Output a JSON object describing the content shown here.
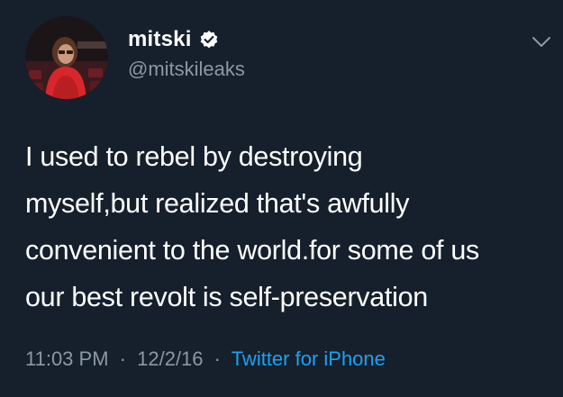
{
  "user": {
    "name": "mitski",
    "handle": "@mitskileaks",
    "verified": true,
    "avatar_icon": "profile-photo"
  },
  "tweet": {
    "lines": [
      "I used to rebel by destroying",
      "myself,but realized that's awfully",
      "convenient to the world.for some of us",
      "our best revolt is self-preservation"
    ],
    "time": "11:03 PM",
    "separator": "·",
    "date": "12/2/16",
    "source": "Twitter for iPhone"
  },
  "colors": {
    "background": "#16202c",
    "text": "#ffffff",
    "muted": "#8b98a5",
    "link": "#1da1f2"
  },
  "icons": {
    "menu": "chevron-down-icon",
    "verified": "verified-badge-icon"
  }
}
